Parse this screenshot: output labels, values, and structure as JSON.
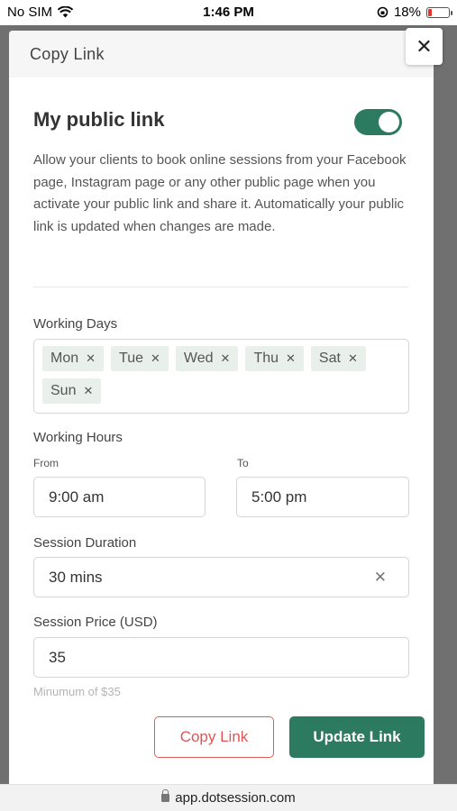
{
  "status_bar": {
    "carrier": "No SIM",
    "time": "1:46 PM",
    "battery_percent": "18%",
    "battery_level": 0.18
  },
  "modal": {
    "title": "Copy Link",
    "section_title": "My public link",
    "public_link_enabled": true,
    "description": "Allow your clients to book online sessions from your Facebook page, Instagram page or any other public page when you activate your public link and share it. Automatically your public link is updated when changes are made.",
    "working_days_label": "Working Days",
    "working_days": [
      "Mon",
      "Tue",
      "Wed",
      "Thu",
      "Sat",
      "Sun"
    ],
    "working_hours_label": "Working Hours",
    "from_label": "From",
    "to_label": "To",
    "from_value": "9:00 am",
    "to_value": "5:00 pm",
    "session_duration_label": "Session Duration",
    "session_duration_value": "30 mins",
    "session_price_label": "Session Price (USD)",
    "session_price_value": "35",
    "price_hint": "Minumum of $35",
    "copy_link_button": "Copy Link",
    "update_link_button": "Update Link"
  },
  "browser": {
    "url": "app.dotsession.com"
  },
  "colors": {
    "accent": "#2c7a5f",
    "danger": "#e05555",
    "chip_bg": "#e9f0ec"
  }
}
